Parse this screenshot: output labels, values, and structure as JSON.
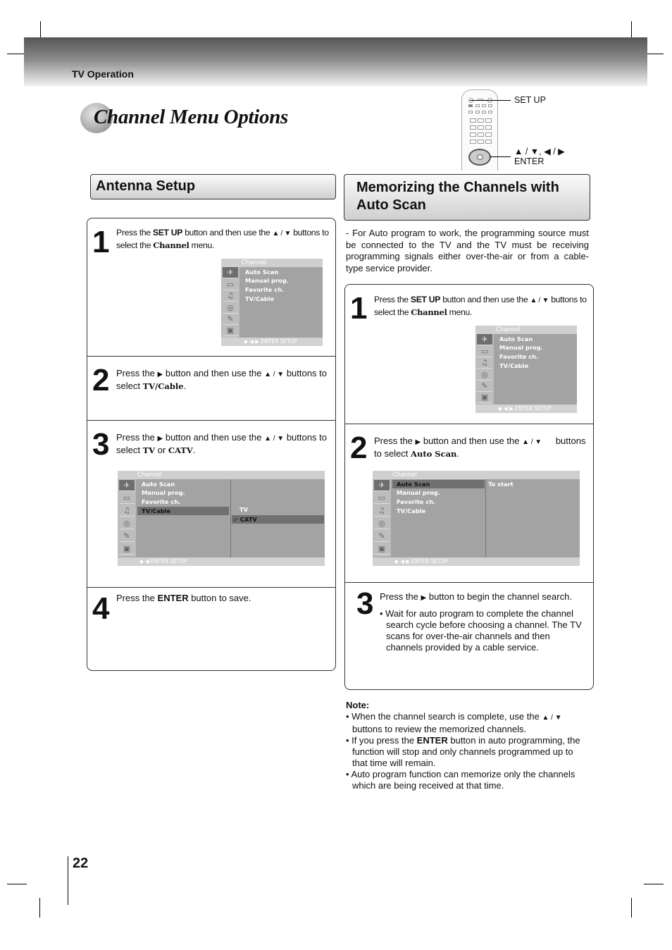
{
  "header": {
    "section": "TV Operation",
    "page_title": "Channel Menu Options",
    "page_number": "22"
  },
  "remote": {
    "setup_label": "SET UP",
    "nav_label": "▲ / ▼, ◀ / ▶",
    "enter_label": "ENTER"
  },
  "antenna_setup": {
    "title": "Antenna Setup",
    "steps": [
      {
        "num": "1",
        "pre": "Press the ",
        "b1": "SET UP",
        "mid": " button and then use the ",
        "arrows": "▲ / ▼",
        "post": " buttons to select the ",
        "b2": "Channel",
        "end": " menu."
      },
      {
        "num": "2",
        "pre": "Press the ",
        "right": "▶",
        "mid": " button and then use the ",
        "arrows": "▲ / ▼",
        "post": " buttons to select ",
        "b2": "TV/Cable",
        "end": "."
      },
      {
        "num": "3",
        "pre": "Press the ",
        "right": "▶",
        "mid": " button and then use the ",
        "arrows": "▲ / ▼",
        "post": " buttons to select ",
        "b2": "TV",
        "or": " or ",
        "b3": "CATV",
        "end": "."
      },
      {
        "num": "4",
        "pre": "Press the ",
        "b1": "ENTER",
        "end": " button to save."
      }
    ]
  },
  "auto_scan": {
    "title_line1": "Memorizing the Channels with",
    "title_line2": "Auto Scan",
    "intro": "- For Auto program to work, the programming source must be connected to the TV and the TV must be receiving programming signals either over-the-air or from a cable-type service provider.",
    "steps": [
      {
        "num": "1",
        "pre": "Press the ",
        "b1": "SET UP",
        "mid": " button and then use the ",
        "arrows": "▲ / ▼",
        "post": " buttons to select the ",
        "b2": "Channel",
        "end": " menu."
      },
      {
        "num": "2",
        "pre": "Press the ",
        "right": "▶",
        "mid": " button and then use the ",
        "arrows": "▲ / ▼",
        "post": " buttons to select ",
        "b2": "Auto Scan",
        "end": "."
      },
      {
        "num": "3",
        "pre": "Press the ",
        "right": "▶",
        "end": " button to begin the channel search.",
        "bullet": "• Wait for auto program to complete the channel search cycle before choosing a channel. The TV scans for over-the-air channels and then channels provided by a cable service."
      }
    ],
    "note_title": "Note:",
    "notes": [
      {
        "pre": "• When the channel search is complete, use the ",
        "arrows": "▲ / ▼",
        "post": " buttons to review the memorized channels."
      },
      {
        "pre": "• If you press the ",
        "bold": "ENTER",
        "post": " button in auto programming, the function will stop and only channels programmed up to that time will remain."
      },
      {
        "pre": "• Auto program function can memorize only the channels which are being received at that time."
      }
    ]
  },
  "osd": {
    "title": "Channel",
    "items": [
      "Auto Scan",
      "Manual prog.",
      "Favorite ch.",
      "TV/Cable"
    ],
    "footer_full": "◆ ◀ ▶ ENTER   SETUP",
    "footer_left": "◆ ◀ ENTER   SETUP",
    "tv_options": [
      "TV",
      "✓ CATV"
    ],
    "auto_scan_option": "To start",
    "icons": [
      "satellite-icon",
      "picture-icon",
      "sound-icon",
      "time-icon",
      "special-icon",
      "screen-icon"
    ]
  }
}
